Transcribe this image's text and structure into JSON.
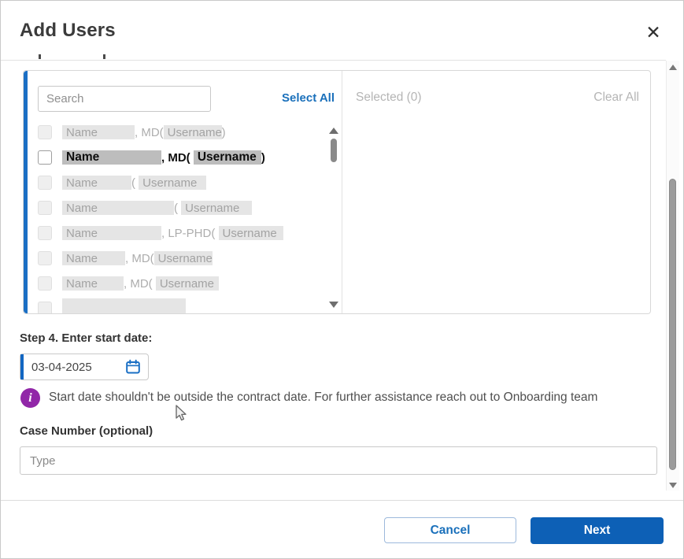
{
  "modal": {
    "title": "Add Users",
    "close_glyph": "✕"
  },
  "picker": {
    "search_placeholder": "Search",
    "select_all": "Select All",
    "selected_header": "Selected (0)",
    "clear_all": "Clear All",
    "rows": [
      {
        "name": "Name",
        "name_w": 92,
        "name_h": 18,
        "sep": ", MD(",
        "user": "Username",
        "user_w": 74,
        "close": ")",
        "style": "dim"
      },
      {
        "name": "Name",
        "name_w": 126,
        "name_h": 18,
        "sep": ", MD( ",
        "user": "Username",
        "user_w": 86,
        "close": ")",
        "style": "active"
      },
      {
        "name": "Name",
        "name_w": 88,
        "name_h": 18,
        "sep": "( ",
        "user": "Username",
        "user_w": 86,
        "close": "",
        "style": "dim"
      },
      {
        "name": "Name",
        "name_w": 142,
        "name_h": 18,
        "sep": "( ",
        "user": "Username",
        "user_w": 90,
        "close": "",
        "style": "dim"
      },
      {
        "name": "Name",
        "name_w": 126,
        "name_h": 18,
        "sep": ", LP-PHD( ",
        "user": "Username",
        "user_w": 82,
        "close": "",
        "style": "dim"
      },
      {
        "name": "Name",
        "name_w": 80,
        "name_h": 18,
        "sep": ", MD(",
        "user": "Username",
        "user_w": 74,
        "close": "",
        "style": "dim"
      },
      {
        "name": "Name",
        "name_w": 78,
        "name_h": 18,
        "sep": ", MD( ",
        "user": "Username",
        "user_w": 80,
        "close": "",
        "style": "dim"
      },
      {
        "name": "",
        "name_w": 157,
        "name_h": 26,
        "sep": "",
        "user": "",
        "user_w": 0,
        "close": "",
        "style": "dim"
      }
    ]
  },
  "step4": {
    "label": "Step 4. Enter start date:",
    "date_value": "03-04-2025",
    "info_glyph": "i",
    "info_text": "Start date shouldn't be outside the contract date. For further assistance reach out to Onboarding team"
  },
  "case_number": {
    "label": "Case Number (optional)",
    "placeholder": "Type"
  },
  "footer": {
    "cancel": "Cancel",
    "next": "Next"
  },
  "colors": {
    "accent_blue": "#1b6fc4",
    "link_blue": "#1a70bb",
    "button_blue": "#0d60b6",
    "info_purple": "#9127a8"
  }
}
